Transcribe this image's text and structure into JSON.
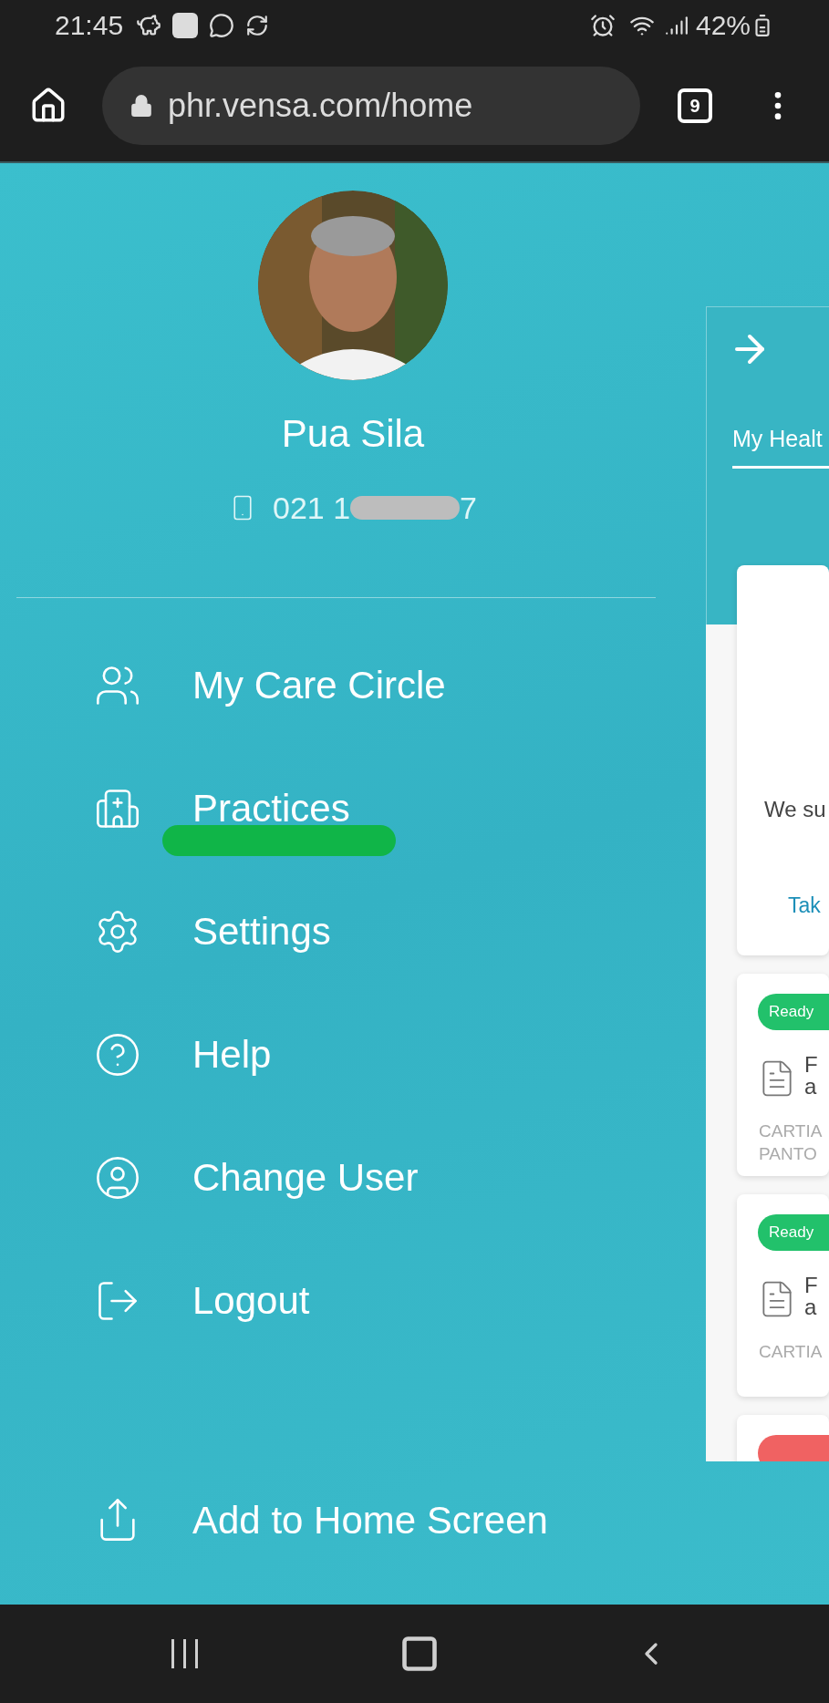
{
  "status_bar": {
    "time": "21:45",
    "battery": "42%"
  },
  "browser": {
    "url": "phr.vensa.com/home",
    "tab_count": "9"
  },
  "profile": {
    "name": "Pua Sila",
    "phone_start": "021 1",
    "phone_end": "7"
  },
  "menu": [
    {
      "label": "My Care Circle",
      "kind": "care-circle",
      "highlighted": false
    },
    {
      "label": "Practices",
      "kind": "practices",
      "highlighted": true
    },
    {
      "label": "Settings",
      "kind": "settings",
      "highlighted": false
    },
    {
      "label": "Help",
      "kind": "help",
      "highlighted": false
    },
    {
      "label": "Change User",
      "kind": "change-user",
      "highlighted": false
    },
    {
      "label": "Logout",
      "kind": "logout",
      "highlighted": false
    }
  ],
  "add_to_home": "Add to Home Screen",
  "panel": {
    "tab": {
      "label": "My Healt",
      "selected": true
    },
    "card_text": "We su",
    "card_link": "Tak",
    "results": [
      {
        "status": "Ready",
        "color": "#22c16b",
        "title_lines": [
          "F",
          "a"
        ],
        "detail_lines": [
          "CARTIA",
          "PANTO"
        ]
      },
      {
        "status": "Ready",
        "color": "#22c16b",
        "title_lines": [
          "F",
          "a"
        ],
        "detail_lines": [
          "CARTIA"
        ]
      },
      {
        "color": "#f06262"
      }
    ]
  }
}
